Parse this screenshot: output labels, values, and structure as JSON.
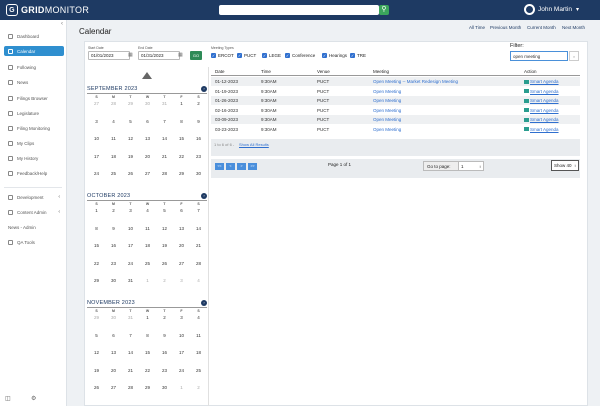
{
  "app": {
    "logo_main": "GRID",
    "logo_sub": "MONITOR"
  },
  "search": {
    "placeholder": "",
    "button_icon": "search-icon"
  },
  "user": {
    "name": "John Martin"
  },
  "sidebar": {
    "items": [
      {
        "label": "Dashboard",
        "icon": "dashboard-icon"
      },
      {
        "label": "Calendar",
        "icon": "calendar-icon"
      },
      {
        "label": "Following",
        "icon": "star-icon"
      },
      {
        "label": "News",
        "icon": "news-icon"
      },
      {
        "label": "Filings Browser",
        "icon": "folder-icon"
      },
      {
        "label": "Legislature",
        "icon": "building-icon"
      },
      {
        "label": "Filing Monitoring",
        "icon": "monitor-icon"
      },
      {
        "label": "My Clips",
        "icon": "clip-icon"
      },
      {
        "label": "My History",
        "icon": "history-icon"
      },
      {
        "label": "Feedback/Help",
        "icon": "help-icon"
      },
      {
        "label": "Development",
        "icon": "code-icon"
      },
      {
        "label": "Content Admin",
        "icon": "admin-icon"
      },
      {
        "label": "News - Admin",
        "icon": ""
      },
      {
        "label": "QA Tools",
        "icon": "tools-icon"
      }
    ]
  },
  "page": {
    "title": "Calendar"
  },
  "top_links": [
    "All Time",
    "Previous Month",
    "Current Month",
    "Next Month"
  ],
  "dates": {
    "start_label": "Start Date",
    "start_value": "01/01/2023",
    "end_label": "End Date",
    "end_value": "01/31/2023",
    "go": "GO"
  },
  "meeting_types": {
    "label": "Meeting Types",
    "items": [
      "ERCOT",
      "PUCT",
      "LEGE",
      "Conference",
      "Hearings",
      "TRE"
    ]
  },
  "filter": {
    "label": "Filter:",
    "value": "open meeting",
    "clear": "×"
  },
  "calendars": [
    {
      "title": "SEPTEMBER 2023",
      "weeks": [
        [
          "27",
          "28",
          "29",
          "30",
          "31",
          "1",
          "2"
        ],
        [
          "3",
          "4",
          "5",
          "6",
          "7",
          "8",
          "9"
        ],
        [
          "10",
          "11",
          "12",
          "13",
          "14",
          "15",
          "16"
        ],
        [
          "17",
          "18",
          "19",
          "20",
          "21",
          "22",
          "23"
        ],
        [
          "24",
          "25",
          "26",
          "27",
          "28",
          "29",
          "30"
        ]
      ]
    },
    {
      "title": "OCTOBER 2023",
      "weeks": [
        [
          "1",
          "2",
          "3",
          "4",
          "5",
          "6",
          "7"
        ],
        [
          "8",
          "9",
          "10",
          "11",
          "12",
          "13",
          "14"
        ],
        [
          "15",
          "16",
          "17",
          "18",
          "19",
          "20",
          "21"
        ],
        [
          "22",
          "23",
          "24",
          "25",
          "26",
          "27",
          "28"
        ],
        [
          "29",
          "30",
          "31",
          "1",
          "2",
          "3",
          "4"
        ]
      ]
    },
    {
      "title": "NOVEMBER 2023",
      "weeks": [
        [
          "29",
          "30",
          "31",
          "1",
          "2",
          "3",
          "4"
        ],
        [
          "5",
          "6",
          "7",
          "8",
          "9",
          "10",
          "11"
        ],
        [
          "12",
          "13",
          "14",
          "15",
          "16",
          "17",
          "18"
        ],
        [
          "19",
          "20",
          "21",
          "22",
          "23",
          "24",
          "25"
        ],
        [
          "26",
          "27",
          "28",
          "29",
          "30",
          "1",
          "2"
        ]
      ]
    }
  ],
  "weekdays": [
    "S",
    "M",
    "T",
    "W",
    "T",
    "F",
    "S"
  ],
  "table": {
    "headers": [
      "Date",
      "Time",
      "Venue",
      "Meeting",
      "Action"
    ],
    "rows": [
      {
        "date": "01-12-2023",
        "time": "9:30AM",
        "venue": "PUCT",
        "meeting": "Open Meeting -- Market Redesign Meeting",
        "action": "Smart Agenda"
      },
      {
        "date": "01-19-2023",
        "time": "9:30AM",
        "venue": "PUCT",
        "meeting": "Open Meeting",
        "action": "Smart Agenda"
      },
      {
        "date": "01-26-2023",
        "time": "9:30AM",
        "venue": "PUCT",
        "meeting": "Open Meeting",
        "action": "Smart Agenda"
      },
      {
        "date": "02-16-2023",
        "time": "9:30AM",
        "venue": "PUCT",
        "meeting": "Open Meeting",
        "action": "Smart Agenda"
      },
      {
        "date": "03-09-2023",
        "time": "9:30AM",
        "venue": "PUCT",
        "meeting": "Open Meeting",
        "action": "Smart Agenda"
      },
      {
        "date": "03-23-2023",
        "time": "9:30AM",
        "venue": "PUCT",
        "meeting": "Open Meeting",
        "action": "Smart Agenda"
      }
    ],
    "footer_count": "1 to 6 of 6 -",
    "footer_link": "Show All Results"
  },
  "pager": {
    "buttons": [
      "<<",
      "<",
      ">",
      ">>"
    ],
    "info": "Page 1 of 1",
    "goto_label": "Go to page:",
    "goto_value": "1",
    "show": "Show 40"
  }
}
